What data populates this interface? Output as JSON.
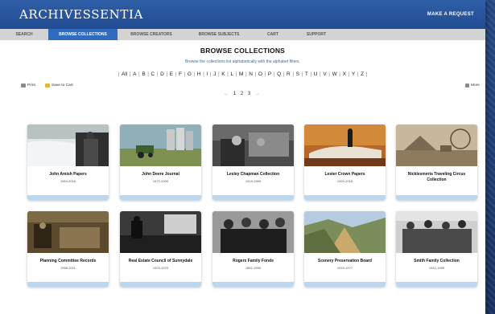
{
  "header": {
    "logo": "ARCHIVESSENTIA",
    "request_button": "MAKE A REQUEST"
  },
  "nav": {
    "tabs": [
      {
        "label": "SEARCH"
      },
      {
        "label": "BROWSE COLLECTIONS",
        "active": true
      },
      {
        "label": "BROWSE CREATORS"
      },
      {
        "label": "BROWSE SUBJECTS"
      },
      {
        "label": "CART"
      },
      {
        "label": "SUPPORT"
      }
    ]
  },
  "main": {
    "heading": "BROWSE COLLECTIONS",
    "subheading": "Browse the collections list alphabetically with the alphabet filters.",
    "alphabet": [
      "All",
      "A",
      "B",
      "C",
      "D",
      "E",
      "F",
      "G",
      "H",
      "I",
      "J",
      "K",
      "L",
      "M",
      "N",
      "O",
      "P",
      "Q",
      "R",
      "S",
      "T",
      "U",
      "V",
      "W",
      "X",
      "Y",
      "Z"
    ],
    "tools": {
      "print": "Print",
      "save_to_cart": "Save to Cart",
      "more": "More"
    },
    "pager": {
      "prev": "←",
      "pages": [
        "1",
        "2",
        "3"
      ],
      "next": "→"
    }
  },
  "collections": [
    {
      "title": "John Amish Papers",
      "dates": "1984-2016"
    },
    {
      "title": "John Deere Journal",
      "dates": "1972-2009"
    },
    {
      "title": "Lesley Chapman Collection",
      "dates": "1919-1969"
    },
    {
      "title": "Lester Crown Papers",
      "dates": "1920-2018"
    },
    {
      "title": "Nicklesmerts Traveling Circus Collection",
      "dates": ""
    },
    {
      "title": "Planning Committee Records",
      "dates": "1958-2011"
    },
    {
      "title": "Real Estate Council of Sunnydale",
      "dates": "1923-1970"
    },
    {
      "title": "Rogers Family Fonds",
      "dates": "1852-1950"
    },
    {
      "title": "Scenery Preservation Board",
      "dates": "1915-1977"
    },
    {
      "title": "Smith Family Collection",
      "dates": "1942-1995"
    }
  ],
  "colors": {
    "header_blue": "#2a58a2",
    "active_tab": "#2f6cc0",
    "card_footer": "#bcd7f0",
    "pager_arrow": "#7fbf3f"
  }
}
